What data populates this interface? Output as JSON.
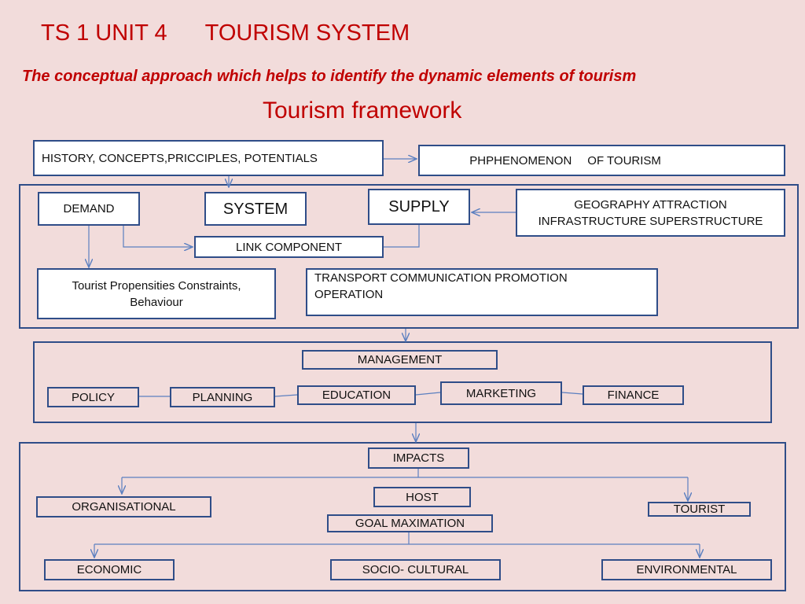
{
  "title": {
    "code": "TS 1 UNIT 4",
    "name": "TOURISM SYSTEM"
  },
  "subtitle": "The conceptual approach which helps to identify the dynamic elements of tourism",
  "framework_heading": "Tourism framework",
  "colors": {
    "background": "#f2dcdb",
    "title": "#c00000",
    "border": "#2f4d88",
    "arrow": "#5b7fc0"
  },
  "top": {
    "history": "HISTORY, CONCEPTS,PRICCIPLES, POTENTIALS",
    "phenomenon_main": "PHPHENOMENON",
    "phenomenon_faint_1": "O",
    "phenomenon_mid": "OF  TOURISM",
    "phenomenon_faint_2": "Of TOURISM"
  },
  "system_block": {
    "demand": "DEMAND",
    "system": "SYSTEM",
    "supply": "SUPPLY",
    "geography_line1": "GEOGRAPHY ATTRACTION",
    "geography_line2": "INFRASTRUCTURE SUPERSTRUCTURE",
    "link": "LINK COMPONENT",
    "tourist_line1": "Tourist Propensities Constraints,",
    "tourist_line2": "Behaviour",
    "transport_line1": "TRANSPORT COMMUNICATION PROMOTION",
    "transport_line2": "OPERATION"
  },
  "management_block": {
    "management": "MANAGEMENT",
    "policy": "POLICY",
    "planning": "PLANNING",
    "education": "EDUCATION",
    "marketing": "MARKETING",
    "finance": "FINANCE"
  },
  "impacts_block": {
    "impacts": "IMPACTS",
    "organisational": "ORGANISATIONAL",
    "host": "HOST",
    "tourist": "TOURIST",
    "goal": "GOAL MAXIMATION",
    "economic": "ECONOMIC",
    "socio": "SOCIO- CULTURAL",
    "environmental": "ENVIRONMENTAL"
  }
}
